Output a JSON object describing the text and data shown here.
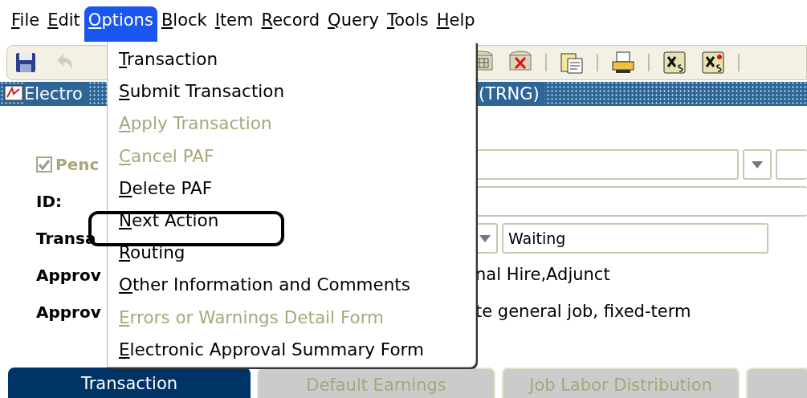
{
  "menubar": [
    {
      "label": "File",
      "selected": false
    },
    {
      "label": "Edit",
      "selected": false
    },
    {
      "label": "Options",
      "selected": true
    },
    {
      "label": "Block",
      "selected": false
    },
    {
      "label": "Item",
      "selected": false
    },
    {
      "label": "Record",
      "selected": false
    },
    {
      "label": "Query",
      "selected": false
    },
    {
      "label": "Tools",
      "selected": false
    },
    {
      "label": "Help",
      "selected": false
    }
  ],
  "toolbar": [
    {
      "kind": "save",
      "disabled": false
    },
    {
      "kind": "undo",
      "disabled": true
    },
    {
      "kind": "gap"
    },
    {
      "kind": "grid",
      "disabled": false
    },
    {
      "kind": "delete",
      "disabled": false
    },
    {
      "kind": "separator"
    },
    {
      "kind": "document",
      "disabled": false
    },
    {
      "kind": "separator"
    },
    {
      "kind": "printer",
      "disabled": false
    },
    {
      "kind": "separator"
    },
    {
      "kind": "xs",
      "disabled": false
    },
    {
      "kind": "xs-flag",
      "disabled": false
    },
    {
      "kind": "separator"
    }
  ],
  "title_bar": {
    "left": "Electro",
    "right": "(TRNG)"
  },
  "form": {
    "pending": {
      "label": "Penc",
      "checked": true,
      "disabled": true
    },
    "rows": [
      {
        "label": "ID:"
      },
      {
        "label": "Transa",
        "value": "Waiting"
      },
      {
        "label": "Approv",
        "text": "nal Hire,Adjunct"
      },
      {
        "label": "Approv",
        "text": "te general job, fixed-term"
      }
    ]
  },
  "menu": [
    {
      "label": "Transaction",
      "disabled": false,
      "highlighted": false
    },
    {
      "label": "Submit Transaction",
      "disabled": false,
      "highlighted": false
    },
    {
      "label": "Apply Transaction",
      "disabled": true,
      "highlighted": false
    },
    {
      "label": "Cancel PAF",
      "disabled": true,
      "highlighted": false
    },
    {
      "label": "Delete PAF",
      "disabled": false,
      "highlighted": false
    },
    {
      "label": "Next Action",
      "disabled": false,
      "highlighted": true
    },
    {
      "label": "Routing",
      "disabled": false,
      "highlighted": false
    },
    {
      "label": "Other Information and Comments",
      "disabled": false,
      "highlighted": false
    },
    {
      "label": "Errors or Warnings Detail Form",
      "disabled": true,
      "highlighted": false
    },
    {
      "label": "Electronic Approval Summary Form",
      "disabled": false,
      "highlighted": false
    }
  ],
  "tabs": [
    {
      "label": "Transaction",
      "selected": true
    },
    {
      "label": "Default Earnings",
      "selected": false
    },
    {
      "label": "Job Labor Distribution",
      "selected": false
    }
  ]
}
